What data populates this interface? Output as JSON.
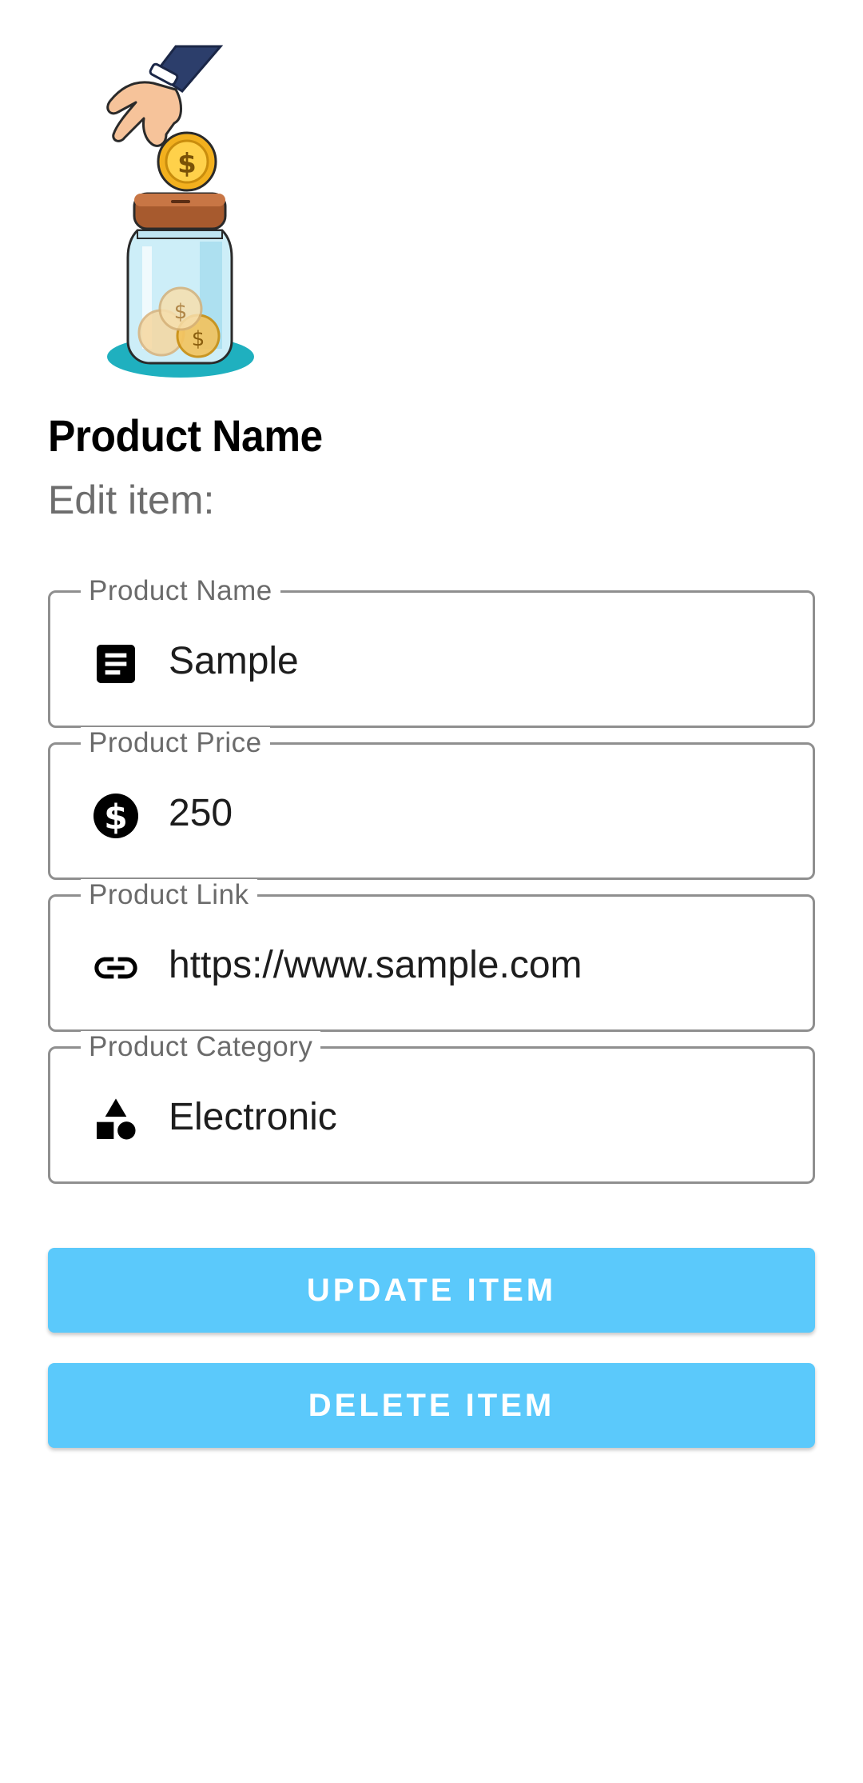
{
  "header": {
    "title": "Product Name",
    "subtitle": "Edit item:",
    "illustration": "coin-jar-illustration"
  },
  "form": {
    "fields": [
      {
        "label": "Product Name",
        "value": "Sample",
        "icon": "notes-icon"
      },
      {
        "label": "Product Price",
        "value": "250",
        "icon": "dollar-icon"
      },
      {
        "label": "Product Link",
        "value": "https://www.sample.com",
        "icon": "link-icon"
      },
      {
        "label": "Product Category",
        "value": "Electronic",
        "icon": "category-icon"
      }
    ]
  },
  "actions": {
    "update_label": "UPDATE ITEM",
    "delete_label": "DELETE ITEM"
  },
  "colors": {
    "button": "#5bc9fb",
    "border": "#8f8f8f",
    "label": "#6b6b6b"
  }
}
